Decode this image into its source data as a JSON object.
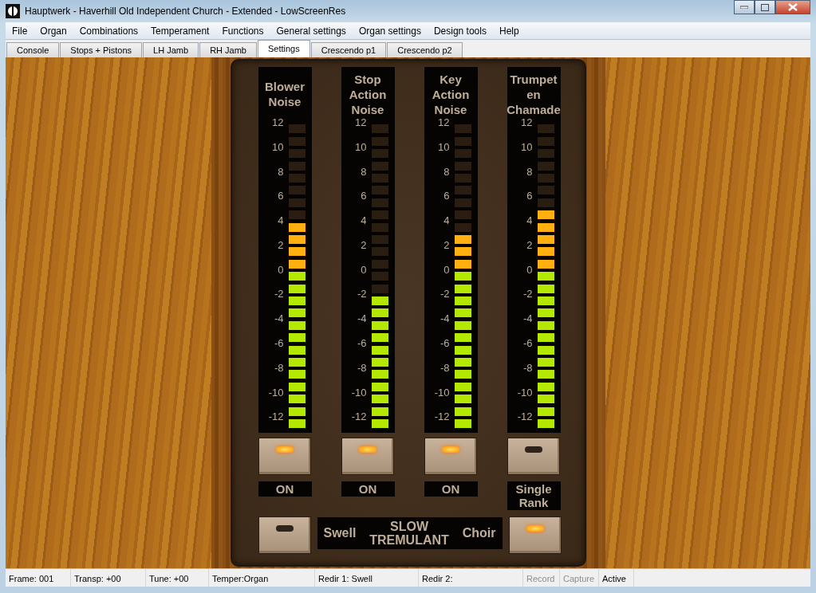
{
  "window": {
    "title": "Hauptwerk - Haverhill Old Independent Church - Extended - LowScreenRes"
  },
  "menu": [
    "File",
    "Organ",
    "Combinations",
    "Temperament",
    "Functions",
    "General settings",
    "Organ settings",
    "Design tools",
    "Help"
  ],
  "tabs": [
    {
      "label": "Console",
      "selected": false
    },
    {
      "label": "Stops + Pistons",
      "selected": false
    },
    {
      "label": "LH Jamb",
      "selected": false
    },
    {
      "label": "RH Jamb",
      "selected": false
    },
    {
      "label": "Settings",
      "selected": true
    },
    {
      "label": "Crescendo p1",
      "selected": false
    },
    {
      "label": "Crescendo p2",
      "selected": false
    }
  ],
  "meters": [
    {
      "title": "Blower Noise",
      "scale": [
        "12",
        "10",
        "8",
        "6",
        "4",
        "2",
        "0",
        "-2",
        "-4",
        "-6",
        "-8",
        "-10",
        "-12"
      ],
      "level": 0.68,
      "lamp_on": true,
      "status": "ON"
    },
    {
      "title": "Stop Action Noise",
      "scale": [
        "12",
        "10",
        "8",
        "6",
        "4",
        "2",
        "0",
        "-2",
        "-4",
        "-6",
        "-8",
        "-10",
        "-12"
      ],
      "level": 0.44,
      "lamp_on": true,
      "status": "ON"
    },
    {
      "title": "Key Action Noise",
      "scale": [
        "12",
        "10",
        "8",
        "6",
        "4",
        "2",
        "0",
        "-2",
        "-4",
        "-6",
        "-8",
        "-10",
        "-12"
      ],
      "level": 0.64,
      "lamp_on": true,
      "status": "ON"
    },
    {
      "title": "Trumpet en Chamade",
      "scale": [
        "12",
        "10",
        "8",
        "6",
        "4",
        "2",
        "0",
        "-2",
        "-4",
        "-6",
        "-8",
        "-10",
        "-12"
      ],
      "level": 0.72,
      "lamp_on": false,
      "status": "Single Rank"
    }
  ],
  "tremulant": {
    "left_lamp_on": false,
    "left_label": "Swell",
    "title": "SLOW TREMULANT",
    "right_label": "Choir",
    "right_lamp_on": true
  },
  "status_bar": [
    {
      "text": "Frame: 001",
      "disabled": false
    },
    {
      "text": "Transp: +00",
      "disabled": false
    },
    {
      "text": "Tune: +00",
      "disabled": false
    },
    {
      "text": "Temper:Organ",
      "disabled": false
    },
    {
      "text": "Redir 1: Swell",
      "disabled": false
    },
    {
      "text": "Redir 2:",
      "disabled": false
    },
    {
      "text": "Record",
      "disabled": true
    },
    {
      "text": "Capture",
      "disabled": true
    },
    {
      "text": "Active",
      "disabled": false
    }
  ]
}
